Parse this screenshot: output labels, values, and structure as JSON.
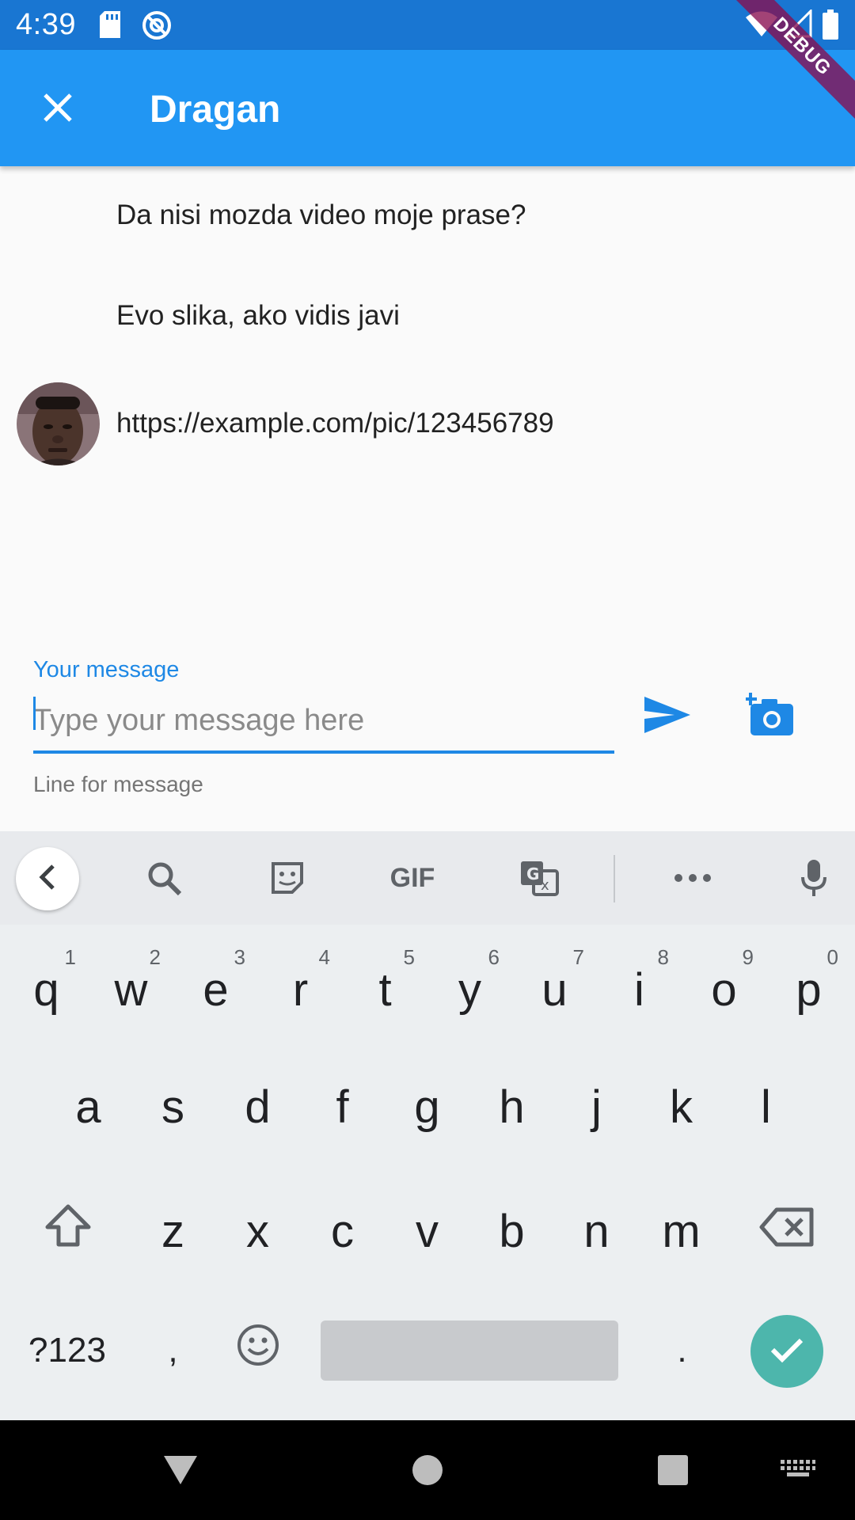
{
  "status_bar": {
    "time": "4:39",
    "icons": [
      "sd-card-icon",
      "at-sign-icon",
      "wifi-icon",
      "signal-icon",
      "battery-icon"
    ]
  },
  "app_bar": {
    "title": "Dragan",
    "close_icon": "close-icon",
    "background": "#2196f3",
    "debug_label": "DEBUG"
  },
  "messages": [
    {
      "text": "Da nisi mozda video moje prase?"
    },
    {
      "text": "Evo slika, ako vidis javi"
    },
    {
      "text": "https://example.com/pic/123456789",
      "has_avatar": true
    }
  ],
  "composer": {
    "label": "Your message",
    "placeholder": "Type your message here",
    "value": "",
    "helper": "Line for message",
    "send_icon": "send-icon",
    "camera_icon": "add-photo-icon",
    "accent": "#1e88e5"
  },
  "keyboard": {
    "toolbar": [
      "back-icon",
      "search-icon",
      "sticker-icon",
      "GIF",
      "translate-icon",
      "more-icon",
      "mic-icon"
    ],
    "gif_label": "GIF",
    "row1": [
      {
        "k": "q",
        "h": "1"
      },
      {
        "k": "w",
        "h": "2"
      },
      {
        "k": "e",
        "h": "3"
      },
      {
        "k": "r",
        "h": "4"
      },
      {
        "k": "t",
        "h": "5"
      },
      {
        "k": "y",
        "h": "6"
      },
      {
        "k": "u",
        "h": "7"
      },
      {
        "k": "i",
        "h": "8"
      },
      {
        "k": "o",
        "h": "9"
      },
      {
        "k": "p",
        "h": "0"
      }
    ],
    "row2": [
      "a",
      "s",
      "d",
      "f",
      "g",
      "h",
      "j",
      "k",
      "l"
    ],
    "row3": [
      "z",
      "x",
      "c",
      "v",
      "b",
      "n",
      "m"
    ],
    "symbols_label": "?123",
    "comma": ",",
    "period": ".",
    "enter_color": "#4db6ac"
  },
  "nav_bar": [
    "back-triangle-icon",
    "home-circle-icon",
    "recents-square-icon",
    "keyboard-switch-icon"
  ]
}
